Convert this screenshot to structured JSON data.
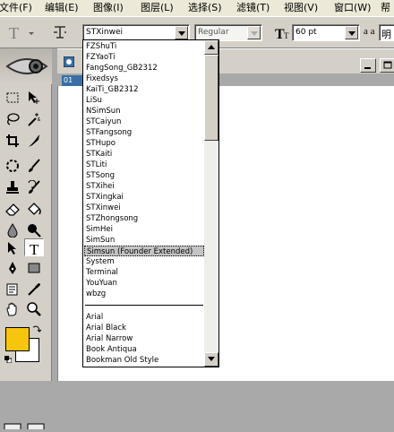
{
  "menubar": {
    "items": [
      "文件(F)",
      "编辑(E)",
      "图像(I)",
      "图层(L)",
      "选择(S)",
      "滤镜(T)",
      "视图(V)",
      "窗口(W)",
      "帮"
    ]
  },
  "options": {
    "font_family": "STXinwei",
    "font_style": "Regular",
    "font_size": "60 pt",
    "aa_label": "a a",
    "aa_value": "明"
  },
  "document": {
    "tab_label": "01"
  },
  "dropdown": {
    "fonts": [
      "FZShuTi",
      "FZYaoTi",
      "FangSong_GB2312",
      "Fixedsys",
      "KaiTi_GB2312",
      "LiSu",
      "NSimSun",
      "STCaiyun",
      "STFangsong",
      "STHupo",
      "STKaiti",
      "STLiti",
      "STSong",
      "STXihei",
      "STXingkai",
      "STXinwei",
      "STZhongsong",
      "SimHei",
      "SimSun",
      "Simsun (Founder Extended)",
      "System",
      "Terminal",
      "YouYuan",
      "wbzg"
    ],
    "selected_font": "Simsun (Founder Extended)",
    "more_fonts": [
      "Arial",
      "Arial Black",
      "Arial Narrow",
      "Book Antiqua",
      "Bookman Old Style"
    ]
  },
  "colors": {
    "foreground": "#f6c50e",
    "background": "#ffffff",
    "menu_bg": "#ece9d8",
    "panel_bg": "#d4d0c8",
    "workspace": "#a9a9a9"
  },
  "icons": {
    "toolbox": [
      "marquee-icon",
      "move-icon",
      "lasso-icon",
      "magic-wand-icon",
      "crop-icon",
      "slice-icon",
      "healing-brush-icon",
      "brush-icon",
      "clone-stamp-icon",
      "history-brush-icon",
      "eraser-icon",
      "paint-bucket-icon",
      "blur-icon",
      "dodge-icon",
      "path-select-icon",
      "type-icon",
      "pen-icon",
      "rectangle-icon",
      "notes-icon",
      "eyedropper-icon",
      "hand-icon",
      "zoom-icon"
    ]
  }
}
